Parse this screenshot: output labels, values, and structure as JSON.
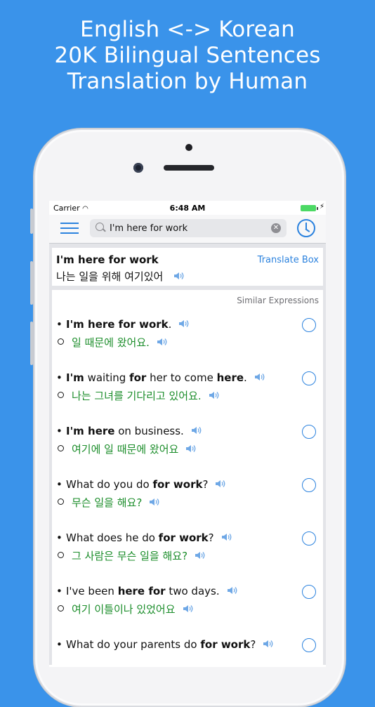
{
  "headline": [
    "English <-> Korean",
    "20K Bilingual Sentences",
    "Translation by Human"
  ],
  "status": {
    "carrier": "Carrier",
    "time": "6:48 AM"
  },
  "search": {
    "value": "I'm here for work"
  },
  "top": {
    "english": "I'm here for work",
    "korean": "나는 일을 위해 여기있어",
    "translate_box": "Translate Box"
  },
  "similar_label": "Similar Expressions",
  "entries": [
    {
      "en": [
        [
          "b",
          "I'm here for work"
        ],
        [
          "t",
          "."
        ]
      ],
      "ko": "일 때문에 왔어요."
    },
    {
      "en": [
        [
          "b",
          "I'm"
        ],
        [
          "t",
          " waiting "
        ],
        [
          "b",
          "for"
        ],
        [
          "t",
          " her to come "
        ],
        [
          "b",
          "here"
        ],
        [
          "t",
          "."
        ]
      ],
      "ko": "나는 그녀를 기다리고 있어요."
    },
    {
      "en": [
        [
          "b",
          "I'm here"
        ],
        [
          "t",
          " on business."
        ]
      ],
      "ko": "여기에 일 때문에 왔어요"
    },
    {
      "en": [
        [
          "t",
          "What do you do "
        ],
        [
          "b",
          "for work"
        ],
        [
          "t",
          "?"
        ]
      ],
      "ko": "무슨 일을 해요?"
    },
    {
      "en": [
        [
          "t",
          "What does he do "
        ],
        [
          "b",
          "for work"
        ],
        [
          "t",
          "?"
        ]
      ],
      "ko": "그 사람은 무슨 일을 해요?"
    },
    {
      "en": [
        [
          "t",
          "I've been "
        ],
        [
          "b",
          "here for"
        ],
        [
          "t",
          " two days."
        ]
      ],
      "ko": "여기 이틀이나 있었어요"
    },
    {
      "en": [
        [
          "t",
          "What do your parents do "
        ],
        [
          "b",
          "for work"
        ],
        [
          "t",
          "?"
        ]
      ],
      "ko": ""
    }
  ],
  "colors": {
    "background": "#3a93ea",
    "accent": "#2b82de",
    "korean_text": "#1b8d2a"
  },
  "icons": [
    "menu-icon",
    "search-icon",
    "clear-icon",
    "history-icon",
    "speaker-icon",
    "radio-icon"
  ]
}
